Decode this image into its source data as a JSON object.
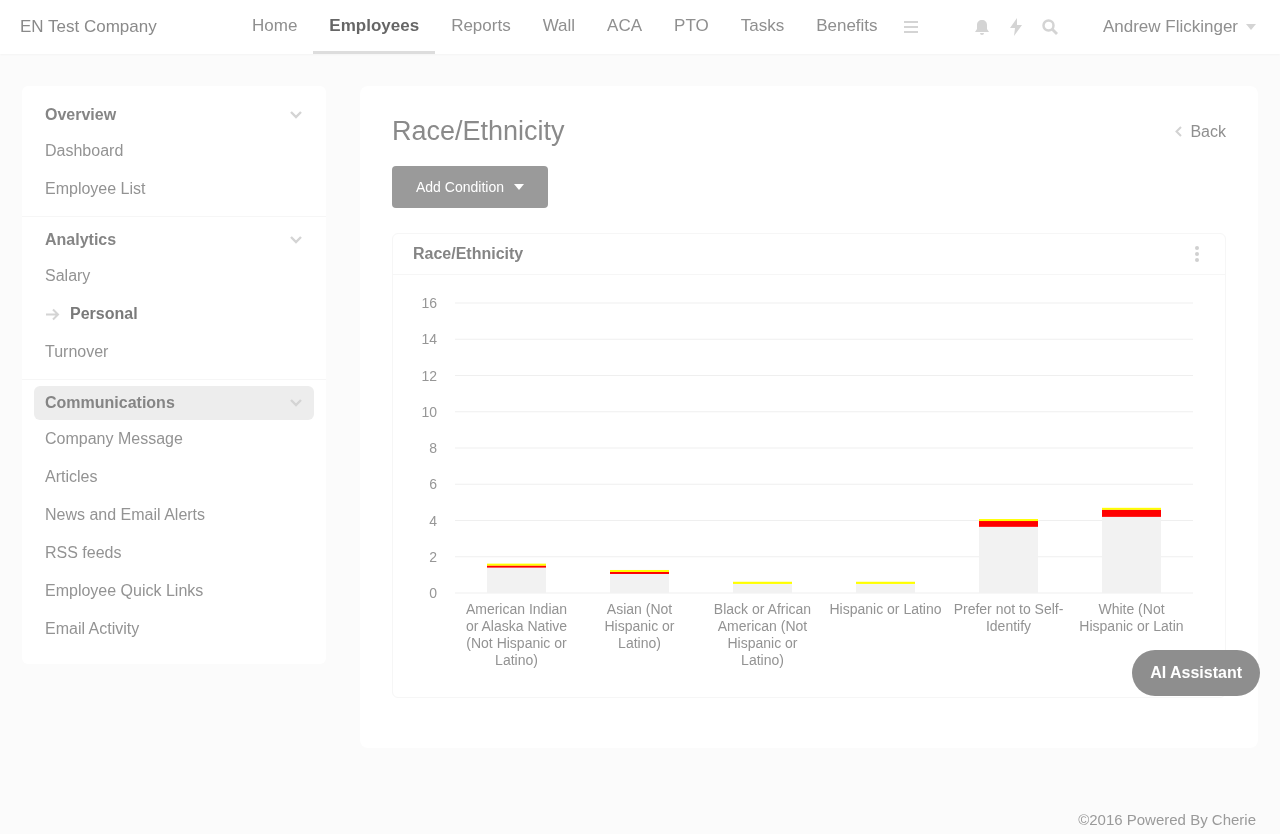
{
  "navbar": {
    "company": "EN Test Company",
    "tabs": [
      {
        "label": "Home",
        "selected": false
      },
      {
        "label": "Employees",
        "selected": true
      },
      {
        "label": "Reports",
        "selected": false
      },
      {
        "label": "Wall",
        "selected": false
      },
      {
        "label": "ACA",
        "selected": false
      },
      {
        "label": "PTO",
        "selected": false
      },
      {
        "label": "Tasks",
        "selected": false
      },
      {
        "label": "Benefits",
        "selected": false
      }
    ],
    "user": "Andrew Flickinger"
  },
  "sidebar": {
    "sections": [
      {
        "title": "Overview",
        "selected": false,
        "items": [
          {
            "label": "Dashboard",
            "selected": false
          },
          {
            "label": "Employee List",
            "selected": false
          }
        ]
      },
      {
        "title": "Analytics",
        "selected": false,
        "items": [
          {
            "label": "Salary",
            "selected": false
          },
          {
            "label": "Personal",
            "selected": true
          },
          {
            "label": "Turnover",
            "selected": false
          }
        ]
      },
      {
        "title": "Communications",
        "selected": true,
        "items": [
          {
            "label": "Company Message",
            "selected": false
          },
          {
            "label": "Articles",
            "selected": false
          },
          {
            "label": "News and Email Alerts",
            "selected": false
          },
          {
            "label": "RSS feeds",
            "selected": false
          },
          {
            "label": "Employee Quick Links",
            "selected": false
          },
          {
            "label": "Email Activity",
            "selected": false
          }
        ]
      }
    ]
  },
  "main": {
    "title": "Race/Ethnicity",
    "back": "Back",
    "add_condition": "Add Condition",
    "panel": {
      "title": "Race/Ethnicity",
      "chart_data": {
        "type": "bar",
        "stacked": true,
        "categories": [
          "American Indian or Alaska Native (Not Hispanic or Latino)",
          "Asian (Not Hispanic or Latino)",
          "Black or African American (Not Hispanic or Latino)",
          "Hispanic or Latino",
          "Prefer not to Self-Identify",
          "White (Not Hispanic or Latin"
        ],
        "ylim": [
          0,
          16
        ],
        "grid": true,
        "yticks": [
          0,
          2,
          4,
          6,
          8,
          10,
          12,
          14,
          16
        ],
        "series": [
          {
            "color": "#f2f2f2",
            "values": [
              1.4,
              1.05,
              0.5,
              0.5,
              3.65,
              4.2
            ]
          },
          {
            "color": "#ff0000",
            "values": [
              0.12,
              0.12,
              0,
              0,
              0.33,
              0.4
            ]
          },
          {
            "color": "#ffff00",
            "values": [
              0.1,
              0.1,
              0.12,
              0.12,
              0.1,
              0.1
            ]
          }
        ]
      }
    }
  },
  "ai_assistant": "AI Assistant",
  "footer": "©2016 Powered By Cherie"
}
